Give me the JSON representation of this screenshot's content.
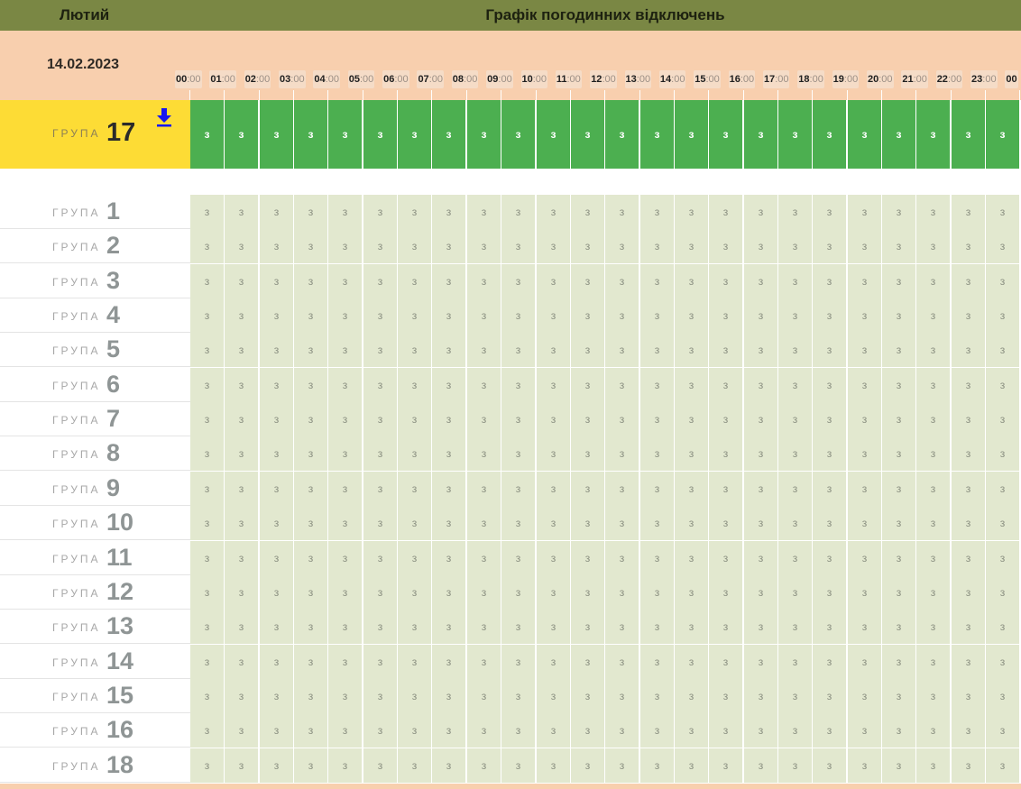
{
  "header": {
    "month": "Лютий",
    "title": "Графік погодинних відключень",
    "date": "14.02.2023"
  },
  "hours": [
    {
      "h": "00",
      "m": ":00"
    },
    {
      "h": "01",
      "m": ":00"
    },
    {
      "h": "02",
      "m": ":00"
    },
    {
      "h": "03",
      "m": ":00"
    },
    {
      "h": "04",
      "m": ":00"
    },
    {
      "h": "05",
      "m": ":00"
    },
    {
      "h": "06",
      "m": ":00"
    },
    {
      "h": "07",
      "m": ":00"
    },
    {
      "h": "08",
      "m": ":00"
    },
    {
      "h": "09",
      "m": ":00"
    },
    {
      "h": "10",
      "m": ":00"
    },
    {
      "h": "11",
      "m": ":00"
    },
    {
      "h": "12",
      "m": ":00"
    },
    {
      "h": "13",
      "m": ":00"
    },
    {
      "h": "14",
      "m": ":00"
    },
    {
      "h": "15",
      "m": ":00"
    },
    {
      "h": "16",
      "m": ":00"
    },
    {
      "h": "17",
      "m": ":00"
    },
    {
      "h": "18",
      "m": ":00"
    },
    {
      "h": "19",
      "m": ":00"
    },
    {
      "h": "20",
      "m": ":00"
    },
    {
      "h": "21",
      "m": ":00"
    },
    {
      "h": "22",
      "m": ":00"
    },
    {
      "h": "23",
      "m": ":00"
    },
    {
      "h": "00",
      "m": ""
    }
  ],
  "group_word": "ГРУПА",
  "selected_group": {
    "number": "17",
    "cells": [
      "з",
      "з",
      "з",
      "з",
      "з",
      "з",
      "з",
      "з",
      "з",
      "з",
      "з",
      "з",
      "з",
      "з",
      "з",
      "з",
      "з",
      "з",
      "з",
      "з",
      "з",
      "з",
      "з",
      "з"
    ],
    "download_icon": "download-icon"
  },
  "groups": [
    {
      "number": "1"
    },
    {
      "number": "2"
    },
    {
      "number": "3"
    },
    {
      "number": "4"
    },
    {
      "number": "5"
    },
    {
      "number": "6"
    },
    {
      "number": "7"
    },
    {
      "number": "8"
    },
    {
      "number": "9"
    },
    {
      "number": "10"
    },
    {
      "number": "11"
    },
    {
      "number": "12"
    },
    {
      "number": "13"
    },
    {
      "number": "14"
    },
    {
      "number": "15"
    },
    {
      "number": "16"
    },
    {
      "number": "18"
    }
  ],
  "cell_value": "з",
  "colors": {
    "header_bar": "#7a8744",
    "date_band": "#f8cfae",
    "selected_label": "#fddc35",
    "selected_cell": "#4caf50",
    "group_cell": "#e2e8cf"
  }
}
